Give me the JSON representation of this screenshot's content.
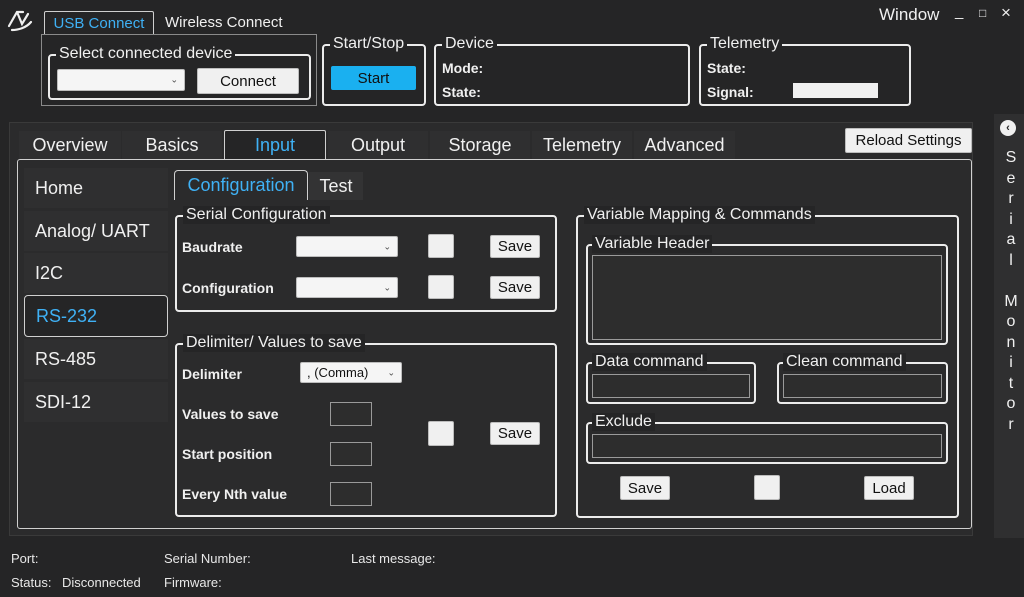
{
  "window": {
    "title": "Window",
    "minimize": "_",
    "maximize": "□",
    "close": "×"
  },
  "connection_tabs": [
    "USB Connect",
    "Wireless Connect"
  ],
  "select_device": {
    "legend": "Select connected device",
    "value": "",
    "connect_label": "Connect"
  },
  "start_stop": {
    "legend": "Start/Stop",
    "start_label": "Start"
  },
  "device": {
    "legend": "Device",
    "mode_label": "Mode:",
    "state_label": "State:"
  },
  "telemetry": {
    "legend": "Telemetry",
    "state_label": "State:",
    "signal_label": "Signal:"
  },
  "reload_label": "Reload Settings",
  "main_tabs": [
    "Overview",
    "Basics",
    "Input",
    "Output",
    "Storage",
    "Telemetry",
    "Advanced"
  ],
  "sidebar": [
    "Home",
    "Analog/ UART",
    "I2C",
    "RS-232",
    "RS-485",
    "SDI-12"
  ],
  "sub_tabs": [
    "Configuration",
    "Test"
  ],
  "serial_config": {
    "legend": "Serial Configuration",
    "baudrate_label": "Baudrate",
    "configuration_label": "Configuration",
    "save_label": "Save"
  },
  "delimiter_group": {
    "legend": "Delimiter/ Values to save",
    "delimiter_label": "Delimiter",
    "delimiter_value": ", (Comma)",
    "values_label": "Values to save",
    "start_label": "Start position",
    "nth_label": "Every Nth value",
    "save_label": "Save"
  },
  "mapping": {
    "legend": "Variable Mapping & Commands",
    "header_legend": "Variable Header",
    "data_legend": "Data command",
    "clean_legend": "Clean command",
    "exclude_legend": "Exclude",
    "save_label": "Save",
    "load_label": "Load"
  },
  "serial_monitor": {
    "letters": [
      "S",
      "e",
      "r",
      "i",
      "a",
      "l",
      " ",
      "M",
      "o",
      "n",
      "i",
      "t",
      "o",
      "r"
    ]
  },
  "status_bar": {
    "port_label": "Port:",
    "status_label": "Status:",
    "status_value": "Disconnected",
    "serial_label": "Serial Number:",
    "firmware_label": "Firmware:",
    "last_label": "Last message:"
  },
  "colors": {
    "accent": "#3fb1f5",
    "start_button": "#1ab0f0",
    "background": "#252526"
  }
}
